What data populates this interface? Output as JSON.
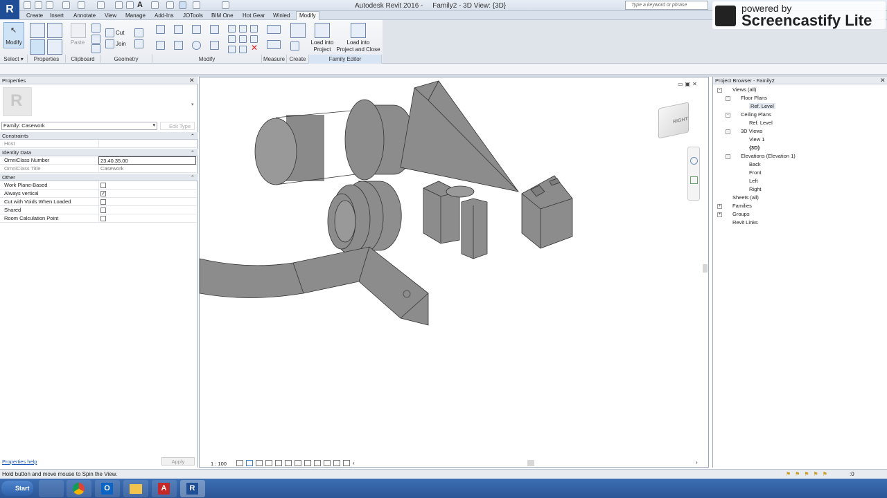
{
  "app": {
    "title": "Autodesk Revit 2016 -     Family2 - 3D View: {3D}",
    "logo": "R",
    "search_placeholder": "Type a keyword or phrase"
  },
  "watermark": {
    "line1": "powered by",
    "line2": "Screencastify Lite"
  },
  "tabs": [
    "Create",
    "Insert",
    "Annotate",
    "View",
    "Manage",
    "Add-Ins",
    "JOTools",
    "BIM One",
    "Hot Gear",
    "Winled",
    "Modify"
  ],
  "ribbon": {
    "modify_label": "Modify",
    "paste_label": "Paste",
    "cut_label": "Cut",
    "join_label": "Join",
    "load_project": [
      "Load into",
      "Project"
    ],
    "load_close": [
      "Load into",
      "Project and Close"
    ],
    "groups": [
      "Select",
      "Properties",
      "Clipboard",
      "Geometry",
      "Modify",
      "Measure",
      "Create",
      "Family Editor"
    ]
  },
  "properties": {
    "title": "Properties",
    "type_selector": "Family: Casework",
    "edit_type": "Edit Type",
    "sections": {
      "constraints": "Constraints",
      "identity": "Identity Data",
      "other": "Other"
    },
    "rows": {
      "host": "Host",
      "omniclass_number": {
        "label": "OmniClass Number",
        "value": "23.40.35.00"
      },
      "omniclass_title": {
        "label": "OmniClass Title",
        "value": "Casework"
      },
      "work_plane": {
        "label": "Work Plane-Based",
        "checked": false
      },
      "always_vertical": {
        "label": "Always vertical",
        "checked": true
      },
      "cut_voids": {
        "label": "Cut with Voids When Loaded",
        "checked": false
      },
      "shared": {
        "label": "Shared",
        "checked": false
      },
      "room_calc": {
        "label": "Room Calculation Point",
        "checked": false
      }
    },
    "help_link": "Properties help",
    "apply_label": "Apply"
  },
  "view": {
    "scale": "1 : 100",
    "viewcube_label": "RIGHT"
  },
  "browser": {
    "title": "Project Browser - Family2",
    "nodes": [
      {
        "label": "Views (all)",
        "level": 0,
        "box": "-"
      },
      {
        "label": "Floor Plans",
        "level": 1,
        "box": "-"
      },
      {
        "label": "Ref. Level",
        "level": 2,
        "box": ""
      },
      {
        "label": "Ceiling Plans",
        "level": 1,
        "box": "-"
      },
      {
        "label": "Ref. Level",
        "level": 2,
        "box": ""
      },
      {
        "label": "3D Views",
        "level": 1,
        "box": "-"
      },
      {
        "label": "View 1",
        "level": 2,
        "box": ""
      },
      {
        "label": "{3D}",
        "level": 2,
        "box": ""
      },
      {
        "label": "Elevations (Elevation 1)",
        "level": 1,
        "box": "-"
      },
      {
        "label": "Back",
        "level": 2,
        "box": ""
      },
      {
        "label": "Front",
        "level": 2,
        "box": ""
      },
      {
        "label": "Left",
        "level": 2,
        "box": ""
      },
      {
        "label": "Right",
        "level": 2,
        "box": ""
      },
      {
        "label": "Sheets (all)",
        "level": 0,
        "box": ""
      },
      {
        "label": "Families",
        "level": 0,
        "box": "+"
      },
      {
        "label": "Groups",
        "level": 0,
        "box": "+"
      },
      {
        "label": "Revit Links",
        "level": 0,
        "box": ""
      }
    ]
  },
  "status": {
    "message": "Hold button and move mouse to Spin the View.",
    "filter_count": ":0"
  },
  "taskbar": {
    "start": "Start"
  }
}
